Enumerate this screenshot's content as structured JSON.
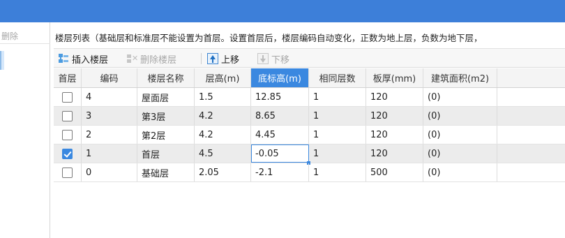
{
  "left_panel": {
    "delete_label": "删除"
  },
  "description": "楼层列表（基础层和标准层不能设置为首层。设置首层后，楼层编码自动变化，正数为地上层，负数为地下层，",
  "toolbar": {
    "insert_label": "插入楼层",
    "delete_label": "删除楼层",
    "move_up_label": "上移",
    "move_down_label": "下移"
  },
  "table": {
    "columns": [
      "首层",
      "编码",
      "楼层名称",
      "层高(m)",
      "底标高(m)",
      "相同层数",
      "板厚(mm)",
      "建筑面积(m2)"
    ],
    "active_column": "底标高(m)",
    "rows": [
      {
        "first_floor": false,
        "code": "4",
        "name": "屋面层",
        "height": "1.5",
        "bottom_elev": "12.85",
        "same_count": "1",
        "slab": "120",
        "area": "(0)"
      },
      {
        "first_floor": false,
        "code": "3",
        "name": "第3层",
        "height": "4.2",
        "bottom_elev": "8.65",
        "same_count": "1",
        "slab": "120",
        "area": "(0)"
      },
      {
        "first_floor": false,
        "code": "2",
        "name": "第2层",
        "height": "4.2",
        "bottom_elev": "4.45",
        "same_count": "1",
        "slab": "120",
        "area": "(0)"
      },
      {
        "first_floor": true,
        "code": "1",
        "name": "首层",
        "height": "4.5",
        "bottom_elev": "-0.05",
        "same_count": "1",
        "slab": "120",
        "area": "(0)"
      },
      {
        "first_floor": false,
        "code": "0",
        "name": "基础层",
        "height": "2.05",
        "bottom_elev": "-2.1",
        "same_count": "1",
        "slab": "500",
        "area": "(0)"
      }
    ]
  },
  "colors": {
    "titlebar": "#3d7fd9",
    "accent": "#3a88e0"
  }
}
